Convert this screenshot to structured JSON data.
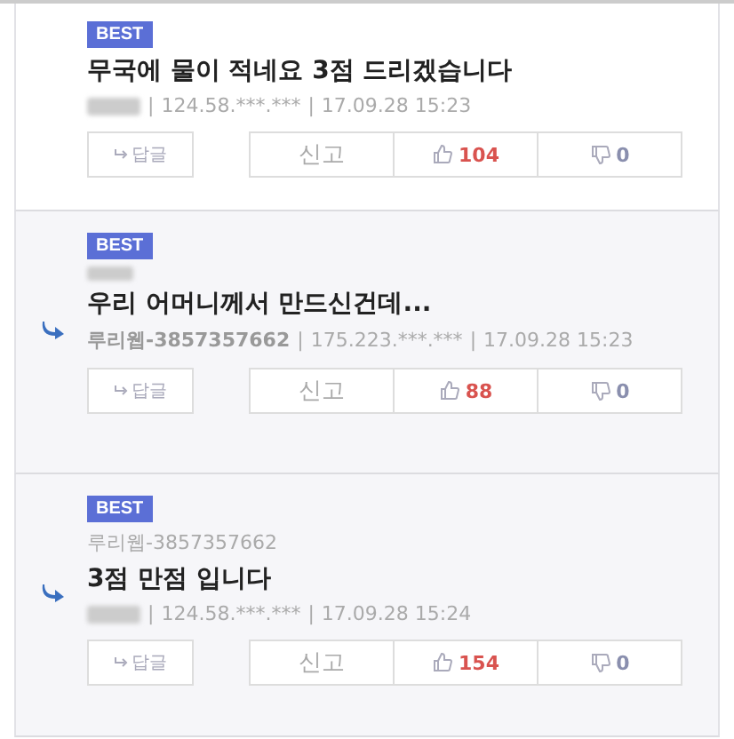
{
  "meta_separator": "|",
  "comments": [
    {
      "kind": "top",
      "badge": "BEST",
      "text": "무국에 물이 적네요 3점 드리겠습니다",
      "author_blurred": true,
      "ip": "124.58.***.***",
      "datetime": "17.09.28 15:23",
      "reply_label": "답글",
      "report": "신고",
      "likes": "104",
      "dislikes": "0"
    },
    {
      "kind": "reply",
      "badge": "BEST",
      "mention_blurred": true,
      "text": "우리 어머니께서 만드신건데...",
      "author": "루리웹-3857357662",
      "ip": "175.223.***.***",
      "datetime": "17.09.28 15:23",
      "reply_label": "답글",
      "report": "신고",
      "likes": "88",
      "dislikes": "0"
    },
    {
      "kind": "reply",
      "badge": "BEST",
      "mention": "루리웹-3857357662",
      "text": "3점 만점 입니다",
      "author_blurred": true,
      "ip": "124.58.***.***",
      "datetime": "17.09.28 15:24",
      "reply_label": "답글",
      "report": "신고",
      "likes": "154",
      "dislikes": "0"
    }
  ]
}
